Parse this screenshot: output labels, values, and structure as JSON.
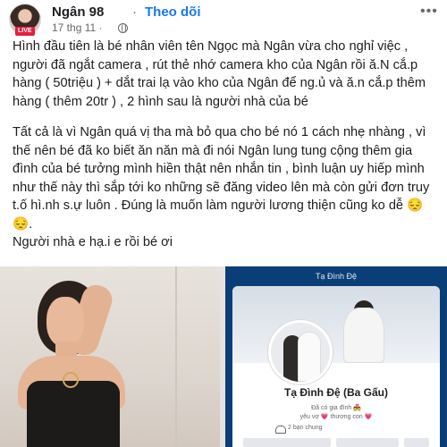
{
  "header": {
    "author": "Ngân 98",
    "separator": "·",
    "follow_label": "Theo dõi",
    "timestamp": "17 thg 11 ·",
    "live_badge": "LIVE",
    "more_icon": "more-horizontal-icon",
    "audience_icon": "globe-icon"
  },
  "post": {
    "paragraphs": [
      "Hình đầu tiên là bé nhân viên tên Ngọc mà Ngân vừa cho nghỉ việc , người đã ngắt camera , rút thẻ nhớ camera kho của Ngân rồi ă.N cắ.p hàng ( 50triệu ) + dắt trai lạ vào kho của Ngân để ng.ủ và ă.n cắ.p thêm hàng ( thêm 20tr ) , 2 hình sau là người nhà của bé",
      "Tất cả là vì Ngân quá vị tha mà bỏ qua cho bé nó 1 cách nhẹ nhàng , vì thế nên bé đã ko biết ăn năn mà đi nói Ngân lung tung cộng thêm gia đình của bé tưởng mình hiền thật nên nhắn tin , bình luận uy hiếp mình như thế này thì sắp tới ko những sẽ đăng video lên mà còn gửi đơn truy t.ố hì.nh s.ự luôn . Đúng là muốn làm người lương thiện cũng ko dễ 😔😔.",
      "Người nhà e  hạ.i e rồi bé ơi"
    ]
  },
  "photos": {
    "right": {
      "topbar_title": "Tạ Đình Đệ",
      "profile_name": "Tạ Đình Đệ (Ba Gấu)",
      "line1": "Đã có gia đình 💑",
      "line2": "yêu vợ 💗 thương con 💗",
      "friends": "2 bạn chung"
    }
  },
  "colors": {
    "accent": "#1877f2",
    "live": "#e41e3f",
    "dark_blue": "#0a3e77"
  }
}
